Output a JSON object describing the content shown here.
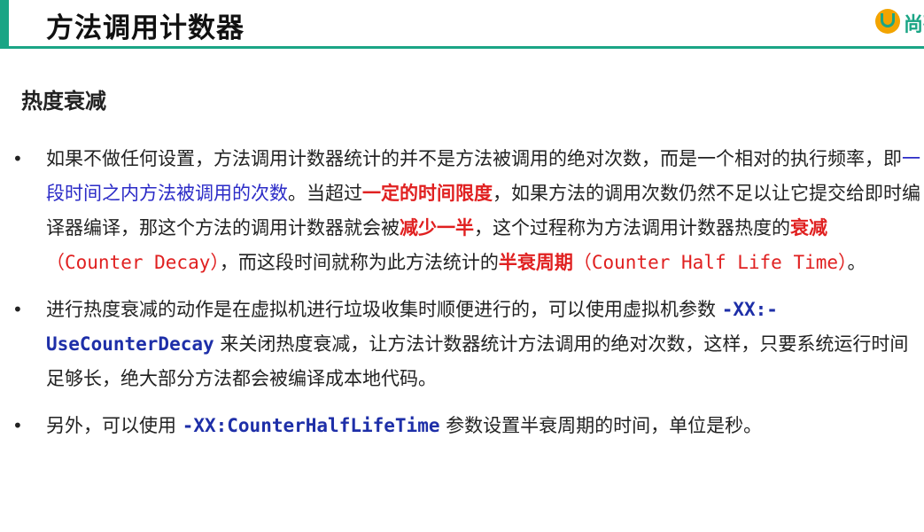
{
  "header": {
    "title": "方法调用计数器",
    "logo_text": "尚硅"
  },
  "section": {
    "subtitle": "热度衰减"
  },
  "bullets": [
    {
      "marker": "•",
      "p1": "如果不做任何设置，方法调用计数器统计的并不是方法被调用的绝对次数，而是一个相对的执行频率，即",
      "highlight_blue": "一段时间之内方法被调用的次数",
      "p2": "。当超过",
      "highlight_red_1": "一定的时间限度",
      "p3": "，如果方法的调用次数仍然不足以让它提交给即时编译器编译，那这个方法的调用计数器就会被",
      "highlight_red_2": "减少一半",
      "p4": "，这个过程称为方法调用计数器热度的",
      "highlight_red_3": "衰减",
      "term_1": "（Counter Decay）",
      "p5": "，而这段时间就称为此方法统计的",
      "highlight_red_4": "半衰周期",
      "term_2": "（Counter Half Life Time）",
      "p6": "。"
    },
    {
      "marker": "•",
      "p1": "进行热度衰减的动作是在虚拟机进行垃圾收集时顺便进行的，可以使用虚拟机参数 ",
      "code": "-XX:-UseCounterDecay",
      "p2": " 来关闭热度衰减，让方法计数器统计方法调用的绝对次数，这样，只要系统运行时间足够长，绝大部分方法都会被编译成本地代码。"
    },
    {
      "marker": "•",
      "p1": "另外，可以使用 ",
      "code": "-XX:CounterHalfLifeTime",
      "p2": " 参数设置半衰周期的时间，单位是秒。"
    }
  ],
  "colors": {
    "accent": "#1aa585",
    "emphasis_red": "#e02020",
    "emphasis_blue": "#2b2bc7",
    "code_blue": "#1e2fa8"
  }
}
